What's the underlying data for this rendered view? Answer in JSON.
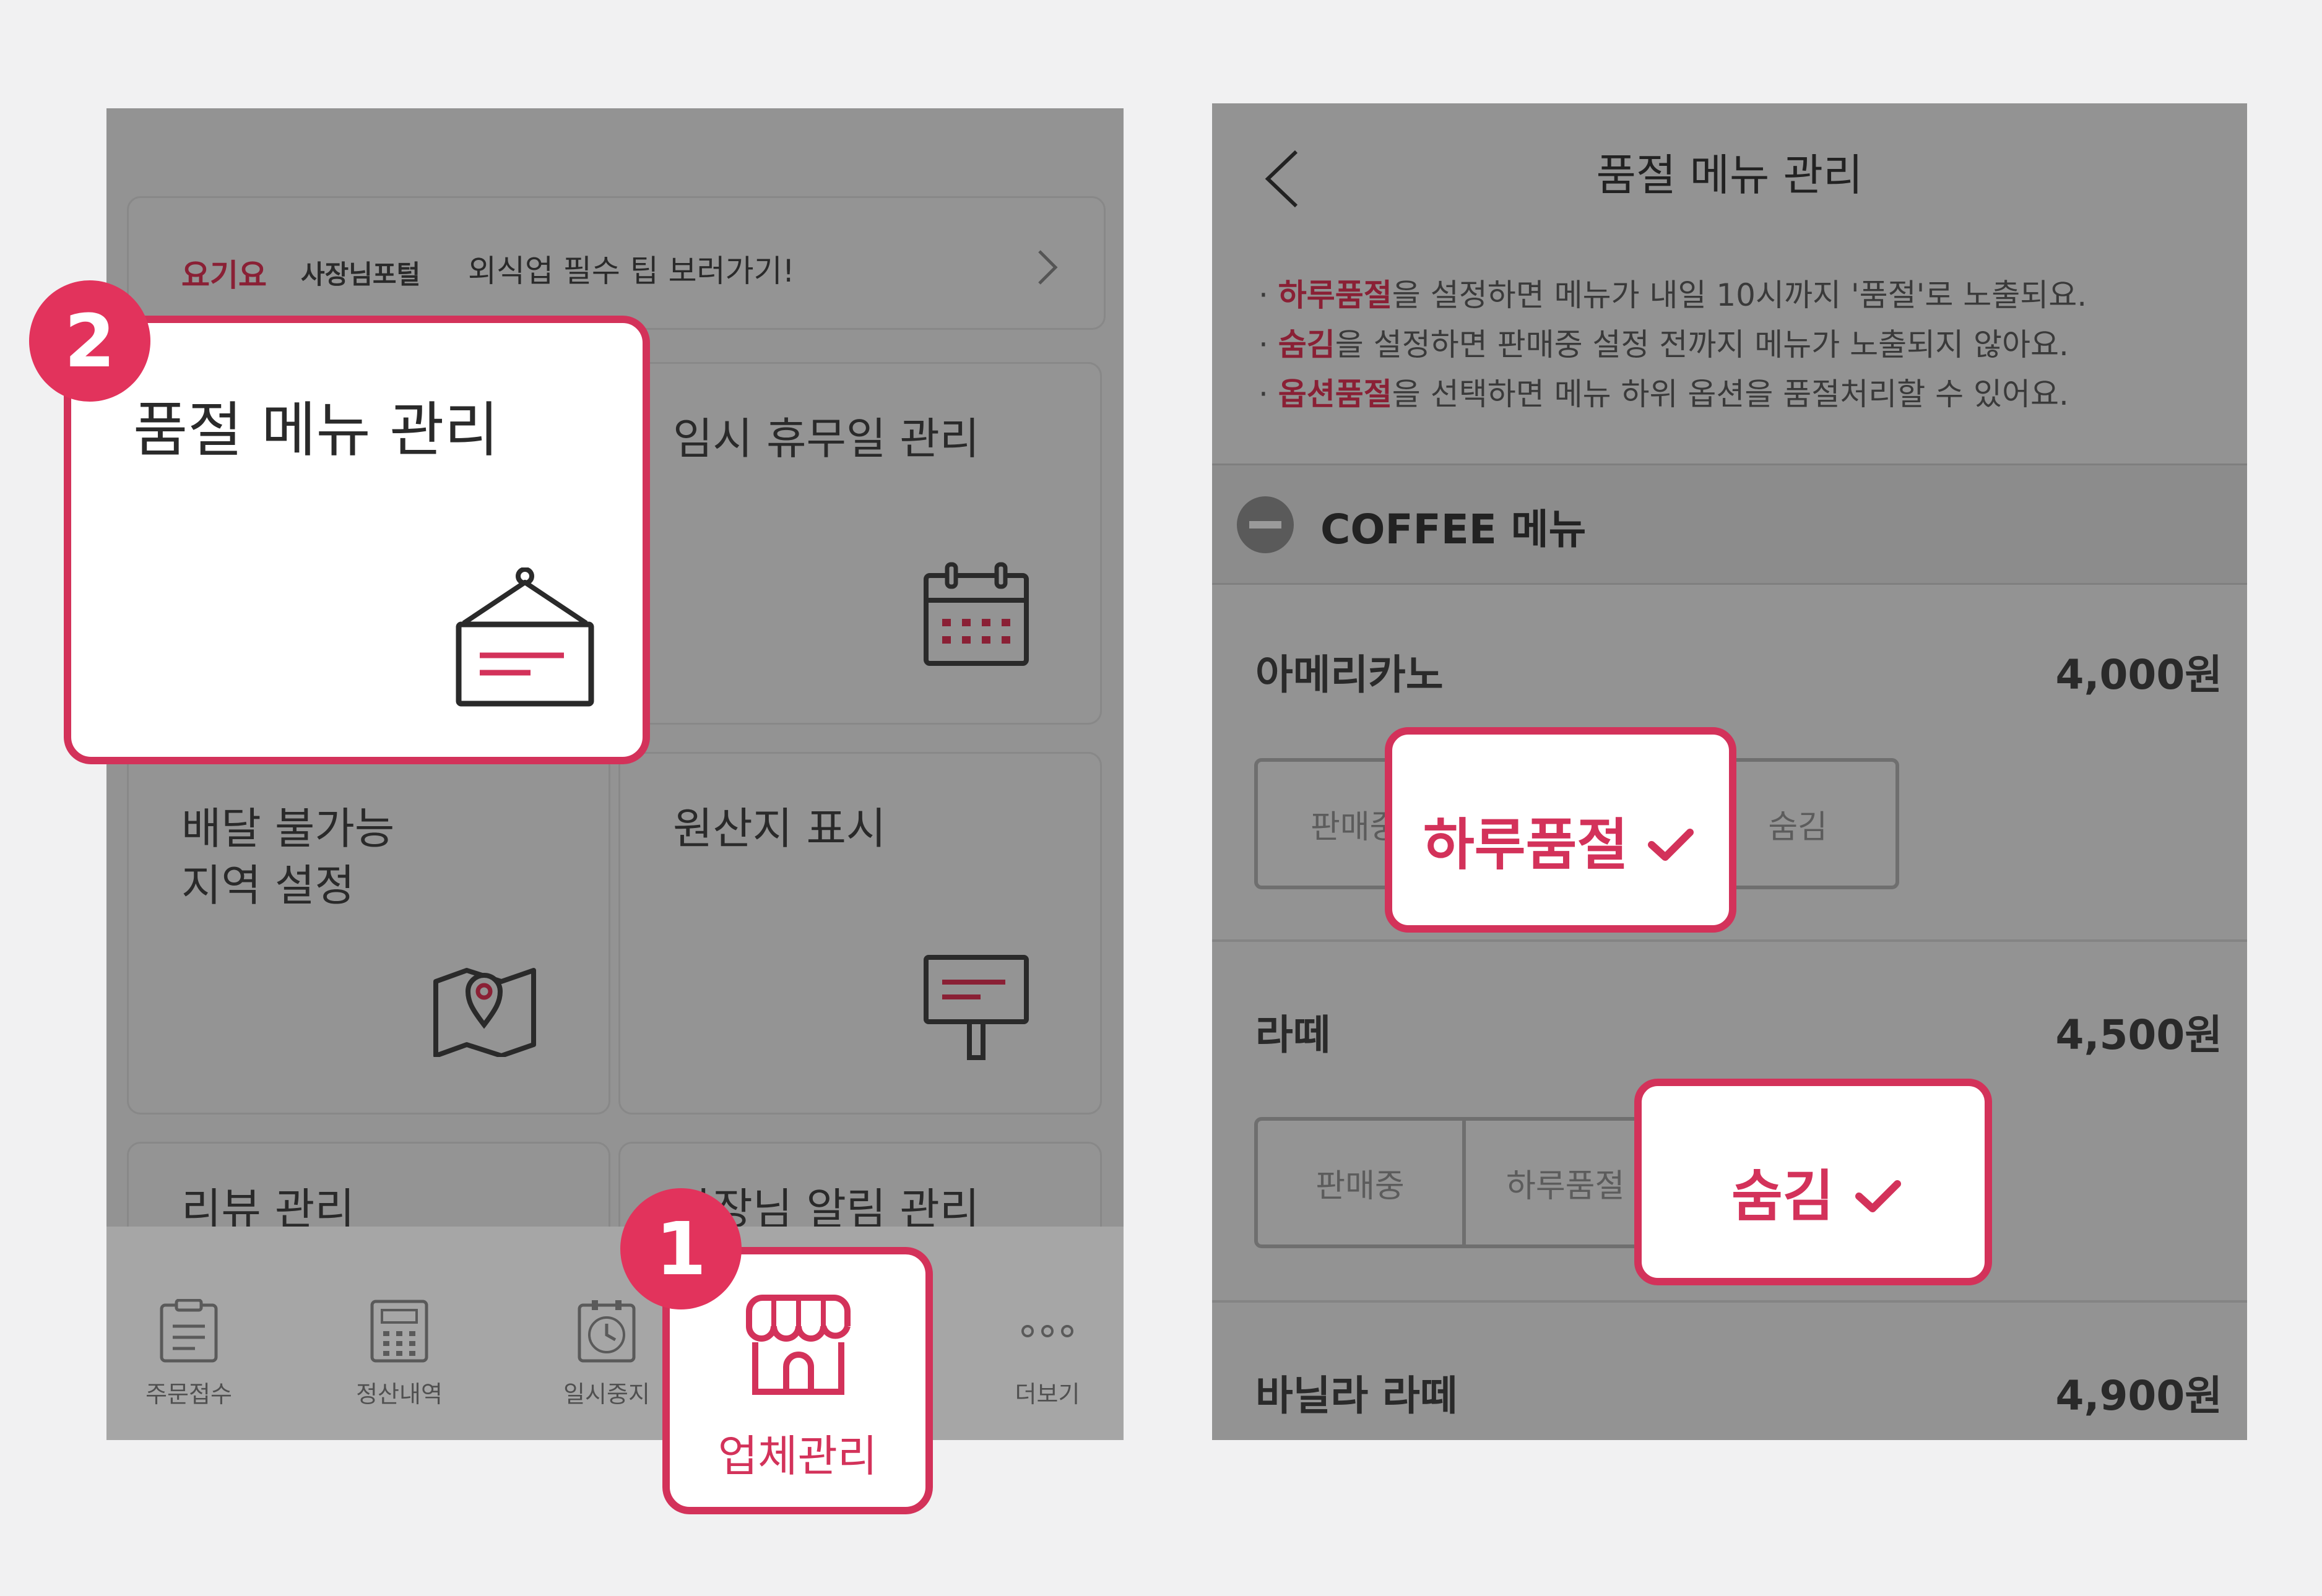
{
  "colors": {
    "accent": "#d3325a",
    "brand": "#8a2035",
    "overlay": "#939393"
  },
  "left": {
    "banner": {
      "brand_red": "요기요",
      "brand_black": "사장님포털",
      "text": "외식업 필수 팁 보러가기!"
    },
    "cards": [
      {
        "title": "품절 메뉴 관리",
        "icon": "sign-board-icon"
      },
      {
        "title": "임시 휴무일 관리",
        "icon": "calendar-icon"
      },
      {
        "title": "배달 불가능\n지역 설정",
        "icon": "map-pin-icon"
      },
      {
        "title": "원산지 표시",
        "icon": "signpost-icon"
      },
      {
        "title": "리뷰 관리"
      },
      {
        "title": "사장님 알림 관리"
      }
    ],
    "tabs": [
      {
        "label": "주문접수",
        "icon": "clipboard-icon"
      },
      {
        "label": "정산내역",
        "icon": "calculator-icon"
      },
      {
        "label": "일시중지",
        "icon": "clock-icon"
      },
      {
        "label": "업체관리",
        "icon": "store-icon"
      },
      {
        "label": "더보기",
        "icon": "more-icon"
      }
    ],
    "badges": [
      "1",
      "2"
    ]
  },
  "right": {
    "title": "품절 메뉴 관리",
    "notes": [
      {
        "em": "하루품절",
        "rest": "을 설정하면 메뉴가 내일 10시까지 '품절'로 노출되요."
      },
      {
        "em": "숨김",
        "rest": "을 설정하면 판매중 설정 전까지 메뉴가 노출되지 않아요."
      },
      {
        "em": "옵션품절",
        "rest": "을 선택하면 메뉴 하위 옵션을 품절처리할 수 있어요."
      }
    ],
    "section": "COFFEE 메뉴",
    "items": [
      {
        "name": "아메리카노",
        "price": "4,000원"
      },
      {
        "name": "라떼",
        "price": "4,500원"
      },
      {
        "name": "바닐라 라떼",
        "price": "4,900원"
      }
    ],
    "states": {
      "selling": "판매중",
      "sold_out_today": "하루품절",
      "hidden": "숨김"
    }
  }
}
